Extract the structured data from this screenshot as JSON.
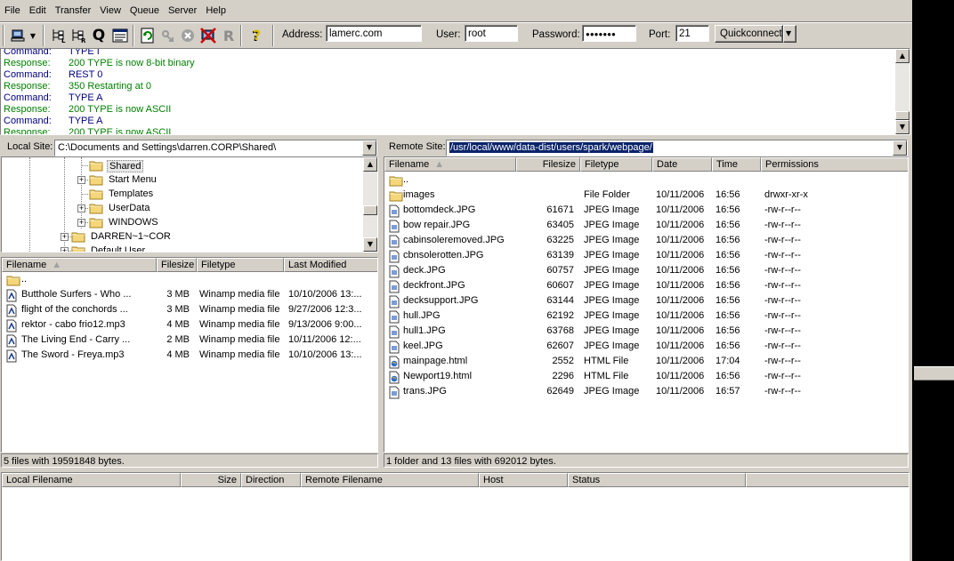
{
  "menu": [
    "File",
    "Edit",
    "Transfer",
    "View",
    "Queue",
    "Server",
    "Help"
  ],
  "quickconnect": {
    "address_label": "Address:",
    "address": "lamerc.com",
    "user_label": "User:",
    "user": "root",
    "password_label": "Password:",
    "password": "●●●●●●●",
    "port_label": "Port:",
    "port": "21",
    "button": "Quickconnect"
  },
  "log": [
    {
      "kind": "Command:",
      "msg": "TYPE I",
      "type": "cmd"
    },
    {
      "kind": "Response:",
      "msg": "200 TYPE is now 8-bit binary",
      "type": "resp"
    },
    {
      "kind": "Command:",
      "msg": "REST 0",
      "type": "cmd"
    },
    {
      "kind": "Response:",
      "msg": "350 Restarting at 0",
      "type": "resp"
    },
    {
      "kind": "Command:",
      "msg": "TYPE A",
      "type": "cmd"
    },
    {
      "kind": "Response:",
      "msg": "200 TYPE is now ASCII",
      "type": "resp"
    },
    {
      "kind": "Command:",
      "msg": "TYPE A",
      "type": "cmd"
    },
    {
      "kind": "Response:",
      "msg": "200 TYPE is now ASCII",
      "type": "resp"
    }
  ],
  "local": {
    "site_label": "Local Site:",
    "path": "C:\\Documents and Settings\\darren.CORP\\Shared\\",
    "tree": [
      {
        "name": "Shared",
        "level": 2,
        "expander": false,
        "selected": true
      },
      {
        "name": "Start Menu",
        "level": 2,
        "expander": true
      },
      {
        "name": "Templates",
        "level": 2,
        "expander": false
      },
      {
        "name": "UserData",
        "level": 2,
        "expander": true
      },
      {
        "name": "WINDOWS",
        "level": 2,
        "expander": true
      },
      {
        "name": "DARREN~1~COR",
        "level": 1,
        "expander": true
      },
      {
        "name": "Default User",
        "level": 1,
        "expander": true
      }
    ],
    "columns": {
      "filename": "Filename",
      "filesize": "Filesize",
      "filetype": "Filetype",
      "modified": "Last Modified"
    },
    "files": [
      {
        "name": "..",
        "size": "",
        "type": "",
        "modified": "",
        "icon": "folder"
      },
      {
        "name": "Butthole Surfers - Who ...",
        "size": "3 MB",
        "type": "Winamp media file",
        "modified": "10/10/2006 13:...",
        "icon": "media"
      },
      {
        "name": "flight of the conchords ...",
        "size": "3 MB",
        "type": "Winamp media file",
        "modified": "9/27/2006 12:3...",
        "icon": "media"
      },
      {
        "name": "rektor - cabo frio12.mp3",
        "size": "4 MB",
        "type": "Winamp media file",
        "modified": "9/13/2006 9:00...",
        "icon": "media"
      },
      {
        "name": "The Living End - Carry ...",
        "size": "2 MB",
        "type": "Winamp media file",
        "modified": "10/11/2006 12:...",
        "icon": "media"
      },
      {
        "name": "The Sword - Freya.mp3",
        "size": "4 MB",
        "type": "Winamp media file",
        "modified": "10/10/2006 13:...",
        "icon": "media"
      }
    ],
    "status": "5 files with 19591848 bytes."
  },
  "remote": {
    "site_label": "Remote Site:",
    "path": "/usr/local/www/data-dist/users/spark/webpage/",
    "columns": {
      "filename": "Filename",
      "filesize": "Filesize",
      "filetype": "Filetype",
      "date": "Date",
      "time": "Time",
      "permissions": "Permissions"
    },
    "files": [
      {
        "name": "..",
        "size": "",
        "type": "",
        "date": "",
        "time": "",
        "perm": "",
        "icon": "folder"
      },
      {
        "name": "images",
        "size": "",
        "type": "File Folder",
        "date": "10/11/2006",
        "time": "16:56",
        "perm": "drwxr-xr-x",
        "icon": "folder"
      },
      {
        "name": "bottomdeck.JPG",
        "size": "61671",
        "type": "JPEG Image",
        "date": "10/11/2006",
        "time": "16:56",
        "perm": "-rw-r--r--",
        "icon": "image"
      },
      {
        "name": "bow repair.JPG",
        "size": "63405",
        "type": "JPEG Image",
        "date": "10/11/2006",
        "time": "16:56",
        "perm": "-rw-r--r--",
        "icon": "image"
      },
      {
        "name": "cabinsoleremoved.JPG",
        "size": "63225",
        "type": "JPEG Image",
        "date": "10/11/2006",
        "time": "16:56",
        "perm": "-rw-r--r--",
        "icon": "image"
      },
      {
        "name": "cbnsolerotten.JPG",
        "size": "63139",
        "type": "JPEG Image",
        "date": "10/11/2006",
        "time": "16:56",
        "perm": "-rw-r--r--",
        "icon": "image"
      },
      {
        "name": "deck.JPG",
        "size": "60757",
        "type": "JPEG Image",
        "date": "10/11/2006",
        "time": "16:56",
        "perm": "-rw-r--r--",
        "icon": "image"
      },
      {
        "name": "deckfront.JPG",
        "size": "60607",
        "type": "JPEG Image",
        "date": "10/11/2006",
        "time": "16:56",
        "perm": "-rw-r--r--",
        "icon": "image"
      },
      {
        "name": "decksupport.JPG",
        "size": "63144",
        "type": "JPEG Image",
        "date": "10/11/2006",
        "time": "16:56",
        "perm": "-rw-r--r--",
        "icon": "image"
      },
      {
        "name": "hull.JPG",
        "size": "62192",
        "type": "JPEG Image",
        "date": "10/11/2006",
        "time": "16:56",
        "perm": "-rw-r--r--",
        "icon": "image"
      },
      {
        "name": "hull1.JPG",
        "size": "63768",
        "type": "JPEG Image",
        "date": "10/11/2006",
        "time": "16:56",
        "perm": "-rw-r--r--",
        "icon": "image"
      },
      {
        "name": "keel.JPG",
        "size": "62607",
        "type": "JPEG Image",
        "date": "10/11/2006",
        "time": "16:56",
        "perm": "-rw-r--r--",
        "icon": "image"
      },
      {
        "name": "mainpage.html",
        "size": "2552",
        "type": "HTML File",
        "date": "10/11/2006",
        "time": "17:04",
        "perm": "-rw-r--r--",
        "icon": "html"
      },
      {
        "name": "Newport19.html",
        "size": "2296",
        "type": "HTML File",
        "date": "10/11/2006",
        "time": "16:56",
        "perm": "-rw-r--r--",
        "icon": "html"
      },
      {
        "name": "trans.JPG",
        "size": "62649",
        "type": "JPEG Image",
        "date": "10/11/2006",
        "time": "16:57",
        "perm": "-rw-r--r--",
        "icon": "image"
      }
    ],
    "status": "1 folder and 13 files with 692012 bytes."
  },
  "queue": {
    "columns": {
      "local": "Local Filename",
      "size": "Size",
      "direction": "Direction",
      "remote": "Remote Filename",
      "host": "Host",
      "status": "Status"
    }
  },
  "icons": {
    "toolbar": [
      "site-manager-icon",
      "dropdown-arrow-icon",
      "toggle-local-tree-icon",
      "toggle-remote-tree-icon",
      "toggle-queue-icon",
      "toggle-log-icon",
      "refresh-icon",
      "process-queue-icon",
      "cancel-icon",
      "disconnect-icon",
      "reconnect-icon",
      "help-icon"
    ]
  }
}
